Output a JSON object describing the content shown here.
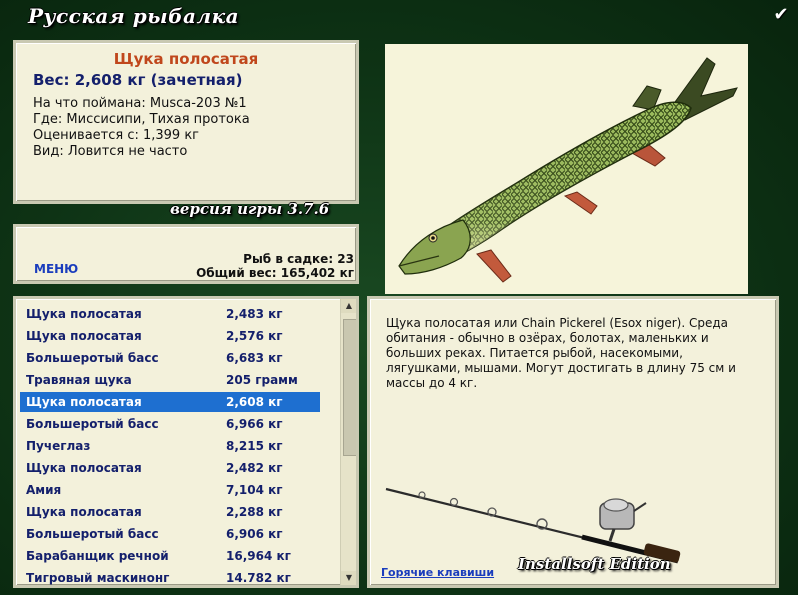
{
  "app_title": "Русская рыбалка",
  "version_label": "версия игры 3.7.6",
  "edition_label": "Installsoft Edition",
  "fish": {
    "name": "Щука полосатая",
    "weight_line": "Вес: 2,608 кг (зачетная)",
    "caught_on": "На что поймана: Musca-203 №1",
    "where": "Где: Миссисипи, Тихая протока",
    "rated_from": "Оценивается с: 1,399 кг",
    "type": "Вид: Ловится не часто"
  },
  "menu_label": "МЕНЮ",
  "cage": {
    "count_text": "Рыб в садке: 23",
    "total_text": "Общий вес: 165,402 кг"
  },
  "catch_list": [
    {
      "name": "Щука полосатая",
      "weight": "2,483 кг"
    },
    {
      "name": "Щука полосатая",
      "weight": "2,576 кг"
    },
    {
      "name": "Большеротый басс",
      "weight": "6,683 кг"
    },
    {
      "name": "Травяная щука",
      "weight": "205 грамм"
    },
    {
      "name": "Щука полосатая",
      "weight": "2,608 кг"
    },
    {
      "name": "Большеротый басс",
      "weight": "6,966 кг"
    },
    {
      "name": "Пучеглаз",
      "weight": "8,215 кг"
    },
    {
      "name": "Щука полосатая",
      "weight": "2,482 кг"
    },
    {
      "name": "Амия",
      "weight": "7,104 кг"
    },
    {
      "name": "Щука полосатая",
      "weight": "2,288 кг"
    },
    {
      "name": "Большеротый басс",
      "weight": "6,906 кг"
    },
    {
      "name": "Барабанщик речной",
      "weight": "16,964 кг"
    },
    {
      "name": "Тигровый маскинонг",
      "weight": "14.782 кг"
    }
  ],
  "selected_index": 4,
  "description": "Щука полосатая или Chain Pickerel (Esox niger). Среда обитания - обычно в озёрах, болотах, маленьких и больших реках. Питается рыбой, насекомыми, лягушками, мышами. Могут достигать в длину 75 см и массы до 4 кг.",
  "hotkeys_label": "Горячие клавиши",
  "icons": {
    "check": "check-icon",
    "scroll_up": "scroll-up-arrow-icon",
    "scroll_down": "scroll-down-arrow-icon"
  },
  "colors": {
    "accent_title": "#c0471c",
    "list_text": "#14206c",
    "selection": "#1e6fd0",
    "link": "#1a3dbd",
    "panel_bg": "#f3f1db",
    "window_bg": "#0e3315"
  }
}
